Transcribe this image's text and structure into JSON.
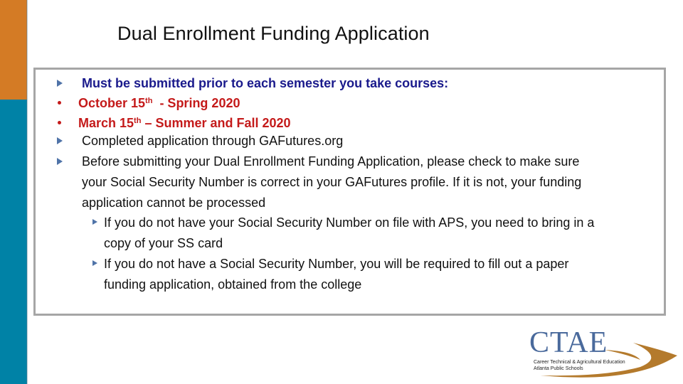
{
  "slide": {
    "title": "Dual Enrollment Funding Application",
    "colors": {
      "sidebar_top": "#d47b25",
      "sidebar_bottom": "#0082a6",
      "heading_blue": "#1a1a8c",
      "date_red": "#c41a1a",
      "bullet_triangle": "#4f73a8",
      "box_border": "#a6a6a6"
    },
    "bullets": [
      {
        "icon": "triangle-bullet",
        "text": "Must be submitted prior to each semester you take courses:"
      },
      {
        "icon": "dot-bullet",
        "prefix": "October 15",
        "sup": "th",
        "suffix": "  - Spring 2020"
      },
      {
        "icon": "dot-bullet",
        "prefix": "March 15",
        "sup": "th",
        "suffix": " – Summer and Fall 2020"
      },
      {
        "icon": "triangle-bullet",
        "text": "Completed application through GAFutures.org"
      },
      {
        "icon": "triangle-bullet",
        "lines": [
          "Before submitting your Dual Enrollment Funding Application, please check to make sure",
          "your Social Security Number is correct in your GAFutures profile. If it is not, your funding",
          "application cannot be processed"
        ]
      }
    ],
    "sub_bullets": [
      {
        "icon": "triangle-bullet",
        "lines": [
          "If you do not have your Social Security Number on file with APS, you need to bring in a",
          "copy of your SS card"
        ]
      },
      {
        "icon": "triangle-bullet",
        "lines": [
          "If you do not have a Social Security Number, you will be required to fill out a paper",
          "funding application, obtained from the college"
        ]
      }
    ],
    "logo": {
      "name": "CTAE",
      "line1": "Career Technical & Agricultural Education",
      "line2": "Atlanta Public Schools"
    }
  }
}
